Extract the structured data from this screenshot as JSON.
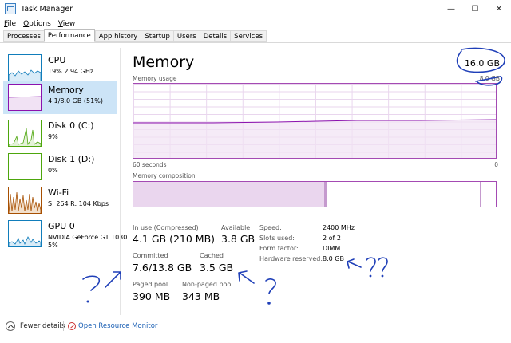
{
  "window": {
    "title": "Task Manager",
    "controls": [
      "—",
      "☐",
      "✕"
    ]
  },
  "menu": [
    {
      "label": "File"
    },
    {
      "label": "Options"
    },
    {
      "label": "View"
    }
  ],
  "tabs": [
    {
      "label": "Processes"
    },
    {
      "label": "Performance",
      "active": true
    },
    {
      "label": "App history"
    },
    {
      "label": "Startup"
    },
    {
      "label": "Users"
    },
    {
      "label": "Details"
    },
    {
      "label": "Services"
    }
  ],
  "sidebar": [
    {
      "name": "CPU",
      "sub": "19% 2.94 GHz",
      "color": "#117dbb"
    },
    {
      "name": "Memory",
      "sub": "4.1/8.0 GB (51%)",
      "color": "#8b12ae",
      "active": true
    },
    {
      "name": "Disk 0 (C:)",
      "sub": "9%",
      "color": "#4da60c"
    },
    {
      "name": "Disk 1 (D:)",
      "sub": "0%",
      "color": "#4da60c"
    },
    {
      "name": "Wi-Fi",
      "sub": "S: 264  R: 104 Kbps",
      "color": "#a74f01"
    },
    {
      "name": "GPU 0",
      "sub": "NVIDIA GeForce GT 1030",
      "sub2": "5%",
      "color": "#117dbb"
    }
  ],
  "main": {
    "title": "Memory",
    "total": "16.0 GB",
    "usage_label": "Memory usage",
    "usage_max": "8.0 GB",
    "axis_left": "60 seconds",
    "axis_right": "0",
    "composition_label": "Memory composition",
    "stats": {
      "in_use_label": "In use (Compressed)",
      "in_use_value": "4.1 GB (210 MB)",
      "available_label": "Available",
      "available_value": "3.8 GB",
      "committed_label": "Committed",
      "committed_value": "7.6/13.8 GB",
      "cached_label": "Cached",
      "cached_value": "3.5 GB",
      "paged_label": "Paged pool",
      "paged_value": "390 MB",
      "nonpaged_label": "Non-paged pool",
      "nonpaged_value": "343 MB"
    },
    "specs": [
      {
        "label": "Speed:",
        "value": "2400 MHz"
      },
      {
        "label": "Slots used:",
        "value": "2 of 2"
      },
      {
        "label": "Form factor:",
        "value": "DIMM"
      },
      {
        "label": "Hardware reserved:",
        "value": "8.0 GB"
      }
    ]
  },
  "footer": {
    "fewer_details": "Fewer details",
    "open_resource_monitor": "Open Resource Monitor"
  },
  "annotations": {
    "color": "#1f3fb8",
    "marks": [
      "?",
      "?",
      "??"
    ]
  },
  "colors": {
    "memory_accent": "#8b12ae",
    "selected_bg": "#cce4f7",
    "link": "#1a5fb4"
  }
}
